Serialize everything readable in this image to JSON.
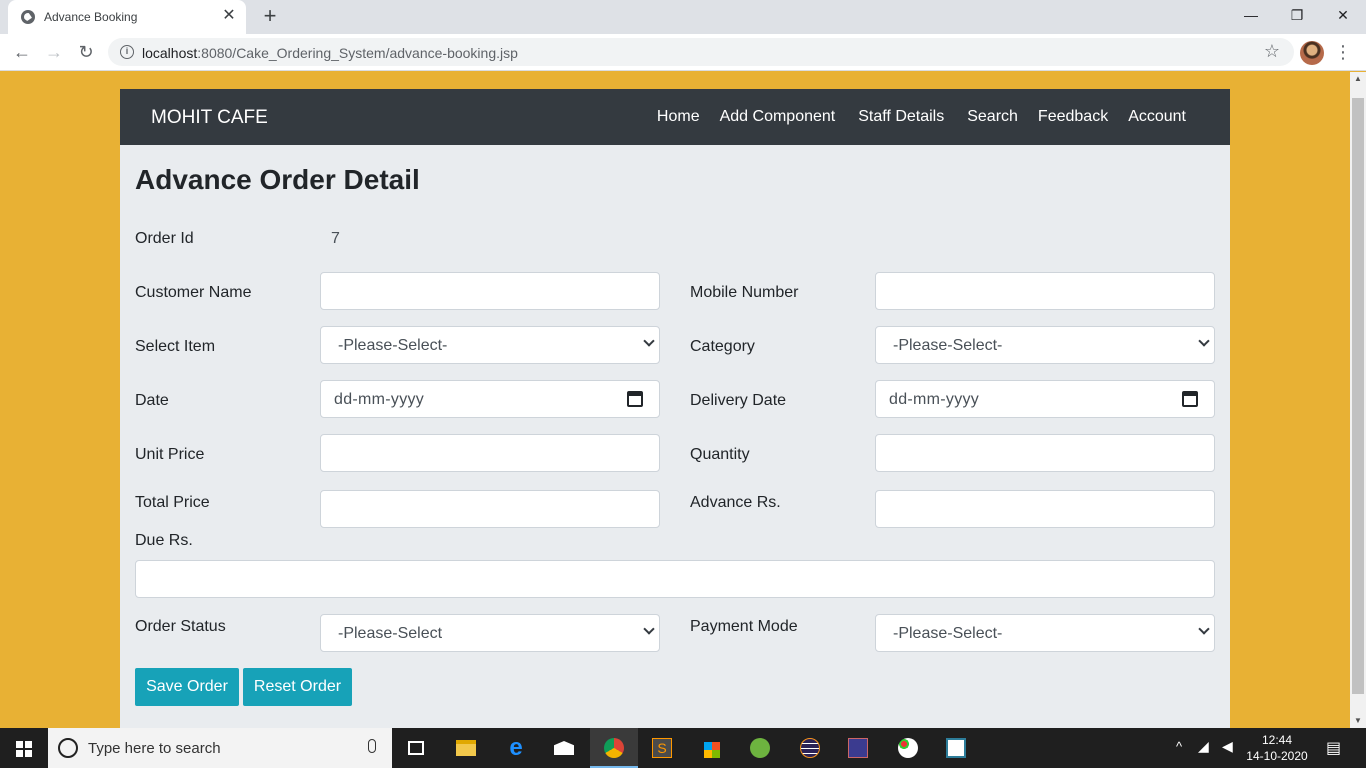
{
  "browser": {
    "tab_title": "Advance Booking",
    "url_host": "localhost",
    "url_rest": ":8080/Cake_Ordering_System/advance-booking.jsp",
    "new_tab_glyph": "+",
    "close_glyph": "✕",
    "minimize_glyph": "—",
    "restore_glyph": "❐",
    "window_close_glyph": "✕",
    "back_glyph": "←",
    "forward_glyph": "→",
    "reload_glyph": "↻",
    "star_glyph": "☆",
    "menu_glyph": "⋮",
    "info_glyph": "i"
  },
  "navbar": {
    "brand": "MOHIT CAFE",
    "links": [
      "Home",
      "Add Component",
      "Staff Details",
      "Search",
      "Feedback",
      "Account"
    ]
  },
  "page": {
    "heading": "Advance Order Detail"
  },
  "form": {
    "order_id_label": "Order Id",
    "order_id_value": "7",
    "customer_name_label": "Customer Name",
    "customer_name_value": "",
    "mobile_number_label": "Mobile Number",
    "mobile_number_value": "",
    "select_item_label": "Select Item",
    "select_item_value": "-Please-Select-",
    "category_label": "Category",
    "category_value": "-Please-Select-",
    "date_label": "Date",
    "date_placeholder": "dd-mm-yyyy",
    "delivery_date_label": "Delivery Date",
    "delivery_date_placeholder": "dd-mm-yyyy",
    "unit_price_label": "Unit Price",
    "unit_price_value": "",
    "quantity_label": "Quantity",
    "quantity_value": "",
    "total_price_label": "Total Price",
    "total_price_value": "",
    "advance_label": "Advance Rs.",
    "advance_value": "",
    "due_label": "Due Rs.",
    "due_value": "",
    "order_status_label": "Order Status",
    "order_status_value": "-Please-Select",
    "payment_mode_label": "Payment Mode",
    "payment_mode_value": "-Please-Select-",
    "save_button": "Save Order",
    "reset_button": "Reset Order"
  },
  "taskbar": {
    "search_placeholder": "Type here to search",
    "time": "12:44",
    "date": "14-10-2020",
    "apps": [
      "task-view",
      "file-explorer",
      "edge",
      "mail",
      "chrome",
      "sublime-text",
      "store",
      "spring-tool",
      "eclipse",
      "game",
      "paint",
      "notepad"
    ]
  },
  "colors": {
    "page_background": "#e8b134",
    "navbar": "#343a40",
    "button": "#17a2b8",
    "container": "#e9ecef"
  }
}
